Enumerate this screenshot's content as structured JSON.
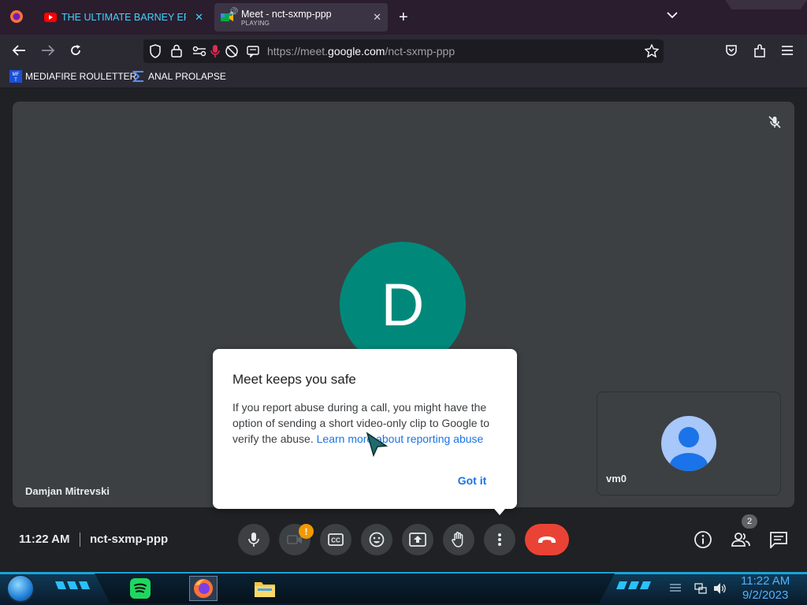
{
  "browser": {
    "tabs": [
      {
        "title": "THE ULTIMATE BARNEY ERROR",
        "favicon": "youtube-icon",
        "active": false
      },
      {
        "title": "Meet - nct-sxmp-ppp",
        "subtitle": "PLAYING",
        "favicon": "meet-icon",
        "active": true
      }
    ],
    "new_tab_symbol": "+",
    "url_prefix": "https://meet.",
    "url_domain": "google.com",
    "url_path": "/nct-sxmp-ppp",
    "bookmarks": [
      {
        "label": "MEDIAFIRE ROULETTER"
      },
      {
        "label": "ANAL PROLAPSE"
      }
    ]
  },
  "meet": {
    "main_participant": {
      "initial": "D",
      "name": "Damjan Mitrevski",
      "avatar_color": "#00897b"
    },
    "self_participant": {
      "name": "vm0"
    },
    "dialog": {
      "title": "Meet keeps you safe",
      "body_text": "If you report abuse during a call, you might have the option of sending a short video-only clip to Google to verify the abuse. ",
      "link_text": "Learn more about reporting abuse",
      "button_label": "Got it"
    },
    "time": "11:22 AM",
    "meeting_code": "nct-sxmp-ppp",
    "camera_warning": "!",
    "people_count": "2"
  },
  "taskbar": {
    "time": "11:22 AM",
    "date": "9/2/2023"
  },
  "colors": {
    "accent_blue": "#1a73e8",
    "hangup_red": "#ea4335",
    "warning_orange": "#f29900"
  }
}
